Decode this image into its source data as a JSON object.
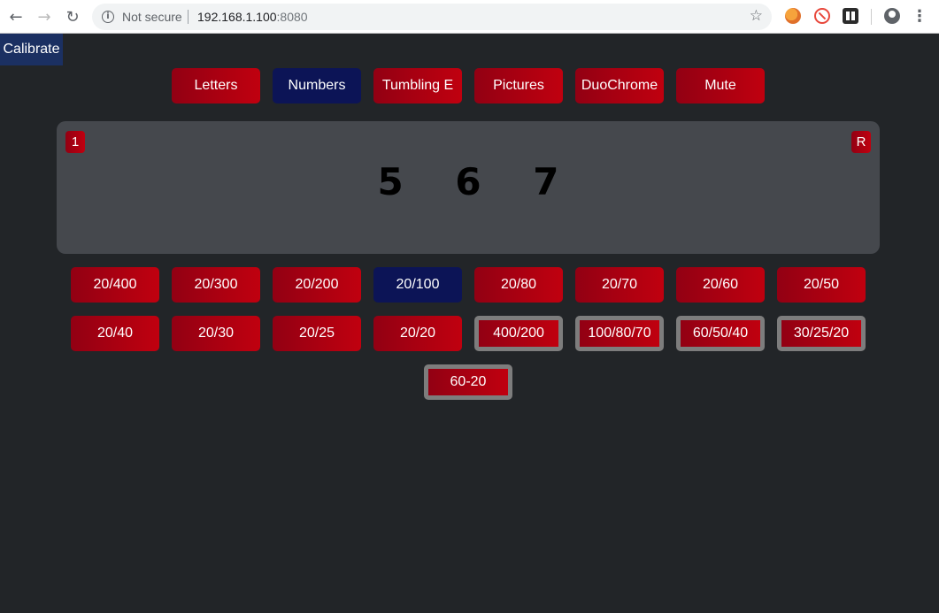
{
  "browser": {
    "security_label": "Not secure",
    "url_host": "192.168.1.100",
    "url_port": ":8080"
  },
  "app": {
    "calibrate_label": "Calibrate",
    "modes": [
      "Letters",
      "Numbers",
      "Tumbling E",
      "Pictures",
      "DuoChrome",
      "Mute"
    ],
    "selected_mode": "Numbers",
    "chart": {
      "left_badge": "1",
      "right_badge": "R",
      "optotypes": "5 6 7"
    },
    "acuity_row1": [
      "20/400",
      "20/300",
      "20/200",
      "20/100",
      "20/80",
      "20/70",
      "20/60",
      "20/50"
    ],
    "acuity_row2": [
      "20/40",
      "20/30",
      "20/25",
      "20/20"
    ],
    "multi_line": [
      "400/200",
      "100/80/70",
      "60/50/40",
      "30/25/20"
    ],
    "range": "60-20",
    "selected_acuity": "20/100"
  },
  "colors": {
    "button_red": "#c0000f",
    "button_active": "#0c1456",
    "background": "#222528",
    "panel": "#45484d"
  }
}
